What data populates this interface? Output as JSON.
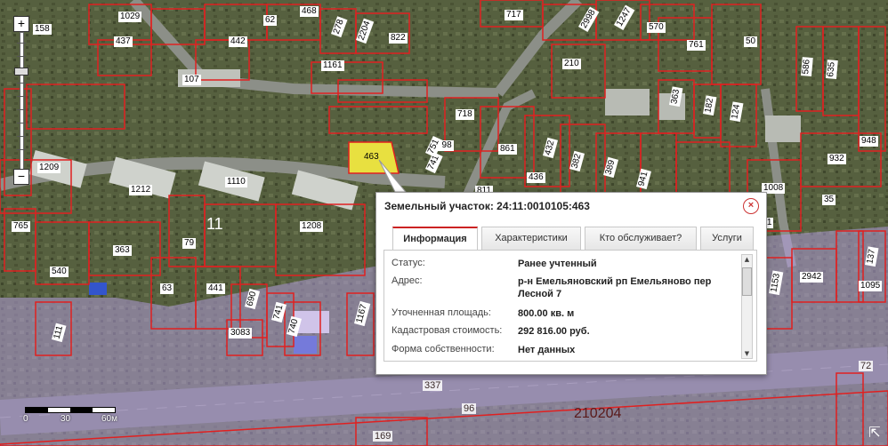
{
  "map": {
    "parcel_labels": [
      "1029",
      "158",
      "468",
      "62",
      "278",
      "2204",
      "717",
      "822",
      "2998",
      "1247",
      "570",
      "437",
      "442",
      "761",
      "50",
      "586",
      "635",
      "1161",
      "210",
      "107",
      "718",
      "363",
      "182",
      "124",
      "948",
      "798",
      "861",
      "741",
      "432",
      "382",
      "389",
      "1209",
      "751",
      "436",
      "941",
      "1008",
      "932",
      "1212",
      "1110",
      "811",
      "35",
      "11",
      "1208",
      "765",
      "79",
      "363",
      "540",
      "63",
      "441",
      "690",
      "741",
      "740",
      "1167",
      "1153",
      "2942",
      "137",
      "1095",
      "111",
      "3083",
      "11"
    ],
    "selected_parcel": "463",
    "block_number": "11",
    "road_labels": [
      "337",
      "96",
      "169",
      "72"
    ],
    "zone_number": "210204"
  },
  "zoom": {
    "plus": "+",
    "minus": "−"
  },
  "scale": {
    "zero": "0",
    "mid": "30",
    "end": "60м"
  },
  "fullscreen_icon": "⇱",
  "popup": {
    "title": "Земельный участок: 24:11:0010105:463",
    "close": "×",
    "tabs": [
      {
        "label": "Информация",
        "active": true
      },
      {
        "label": "Характеристики",
        "active": false
      },
      {
        "label": "Кто обслуживает?",
        "active": false
      },
      {
        "label": "Услуги",
        "active": false
      }
    ],
    "fields": [
      {
        "key": "Статус:",
        "value": "Ранее учтенный"
      },
      {
        "key": "Адрес:",
        "value": "р-н Емельяновский рп Емельяново пер Лесной 7"
      },
      {
        "key": "Уточненная площадь:",
        "value": "800.00 кв. м"
      },
      {
        "key": "Кадастровая стоимость:",
        "value": "292 816.00 руб."
      },
      {
        "key": "Форма собственности:",
        "value": "Нет данных"
      }
    ]
  },
  "colors": {
    "parcel_border": "#e02020",
    "selected_fill": "#e8e040",
    "zone_overlay": "#b8a0e8",
    "tab_accent": "#cc2222"
  }
}
